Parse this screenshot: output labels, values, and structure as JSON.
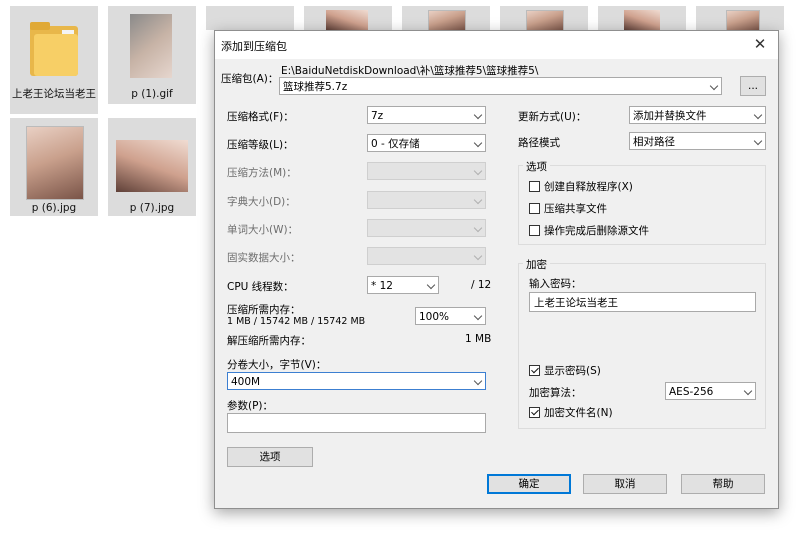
{
  "explorer": {
    "folder_label": "上老王论坛当老王",
    "files": [
      {
        "label": "p (1).gif"
      },
      {
        "label": "p (6).jpg"
      },
      {
        "label": "p (7).jpg"
      }
    ]
  },
  "dialog": {
    "title": "添加到压缩包",
    "archive_label": "压缩包(A)：",
    "archive_path": "E:\\BaiduNetdiskDownload\\补\\篮球推荐5\\篮球推荐5\\",
    "archive_name": "篮球推荐5.7z",
    "browse_label": "...",
    "format_label": "压缩格式(F)：",
    "format_value": "7z",
    "level_label": "压缩等级(L)：",
    "level_value": "0 - 仅存储",
    "method_label": "压缩方法(M)：",
    "dict_label": "字典大小(D)：",
    "word_label": "单词大小(W)：",
    "solid_label": "固实数据大小：",
    "cpu_label": "CPU 线程数：",
    "cpu_value": "* 12",
    "cpu_total": "/ 12",
    "mem_label": "压缩所需内存：",
    "mem_value": "1 MB / 15742 MB / 15742 MB",
    "mem_percent": "100%",
    "decomp_label": "解压缩所需内存：",
    "decomp_value": "1 MB",
    "split_label": "分卷大小，字节(V)：",
    "split_value": "400M",
    "params_label": "参数(P)：",
    "params_value": "",
    "options_button": "选项",
    "update_label": "更新方式(U)：",
    "update_value": "添加并替换文件",
    "pathmode_label": "路径模式",
    "pathmode_value": "相对路径",
    "options_group": {
      "title": "选项",
      "sfx": "创建自释放程序(X)",
      "shared": "压缩共享文件",
      "delete": "操作完成后删除源文件"
    },
    "encrypt_group": {
      "title": "加密",
      "password_label": "输入密码：",
      "password_value": "上老王论坛当老王",
      "show_password": "显示密码(S)",
      "method_label": "加密算法：",
      "method_value": "AES-256",
      "encrypt_names": "加密文件名(N)"
    },
    "ok": "确定",
    "cancel": "取消",
    "help": "帮助",
    "close_glyph": "✕"
  }
}
